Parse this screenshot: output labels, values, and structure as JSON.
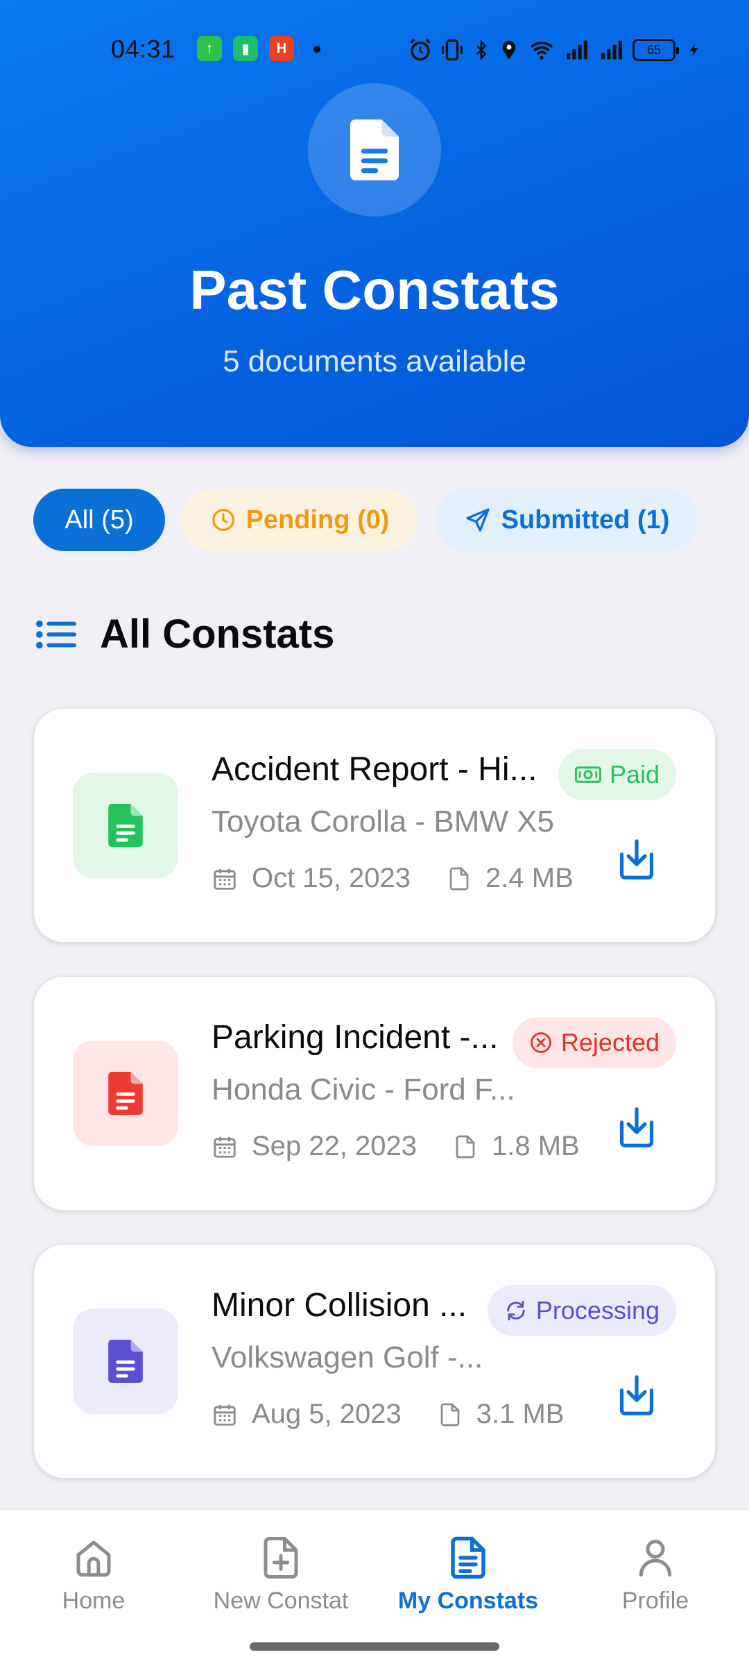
{
  "status_bar": {
    "time": "04:31",
    "battery": "65"
  },
  "header": {
    "title": "Past Constats",
    "subtitle": "5 documents available"
  },
  "filters": [
    {
      "label": "All (5)",
      "active": true
    },
    {
      "label": "Pending (0)",
      "icon": "clock-icon"
    },
    {
      "label": "Submitted (1)",
      "icon": "send-icon"
    }
  ],
  "section": {
    "title": "All Constats",
    "icon": "list-icon"
  },
  "cards": [
    {
      "title": "Accident Report - Hi...",
      "vehicles": "Toyota Corolla - BMW X5",
      "date": "Oct 15, 2023",
      "size": "2.4 MB",
      "status": "Paid",
      "accent": "#27c15c"
    },
    {
      "title": "Parking Incident -...",
      "vehicles": "Honda Civic - Ford F...",
      "date": "Sep 22, 2023",
      "size": "1.8 MB",
      "status": "Rejected",
      "accent": "#ef3b33"
    },
    {
      "title": "Minor Collision ...",
      "vehicles": "Volkswagen Golf -...",
      "date": "Aug 5, 2023",
      "size": "3.1 MB",
      "status": "Processing",
      "accent": "#5b4fd0"
    }
  ],
  "nav": [
    {
      "label": "Home",
      "icon": "home-icon"
    },
    {
      "label": "New Constat",
      "icon": "file-plus-icon"
    },
    {
      "label": "My Constats",
      "icon": "file-text-icon",
      "active": true
    },
    {
      "label": "Profile",
      "icon": "person-icon"
    }
  ],
  "colors": {
    "primary": "#0b6fd8",
    "pending": "#f0a020",
    "paid": "#27c15c",
    "rejected": "#ef3b33",
    "processing": "#5b4fd0"
  }
}
